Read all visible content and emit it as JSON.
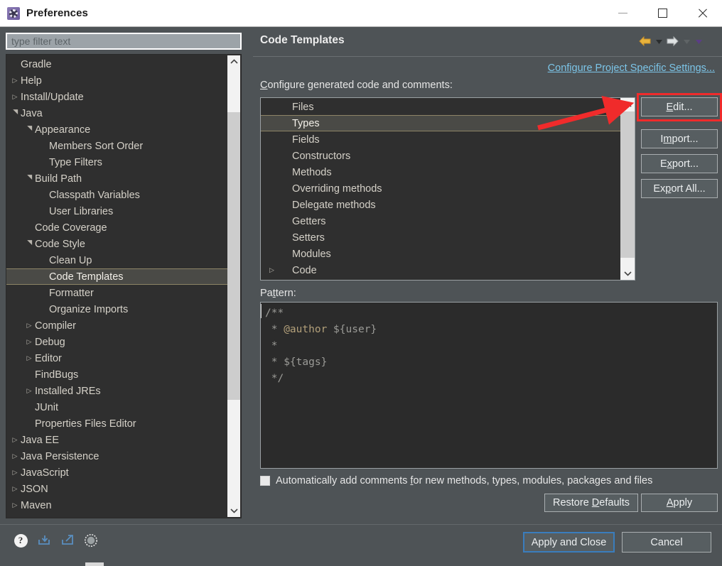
{
  "window": {
    "title": "Preferences",
    "app_icon": "gear-icon",
    "minimize": "—",
    "maximize": "□",
    "close": "✕"
  },
  "filter": {
    "placeholder": "type filter text",
    "value": ""
  },
  "sidebar": {
    "items": [
      {
        "label": "Gradle",
        "indent": 0,
        "twisty": "none",
        "selected": false
      },
      {
        "label": "Help",
        "indent": 0,
        "twisty": "collapsed",
        "selected": false
      },
      {
        "label": "Install/Update",
        "indent": 0,
        "twisty": "collapsed",
        "selected": false
      },
      {
        "label": "Java",
        "indent": 0,
        "twisty": "expanded",
        "selected": false
      },
      {
        "label": "Appearance",
        "indent": 1,
        "twisty": "expanded",
        "selected": false
      },
      {
        "label": "Members Sort Order",
        "indent": 2,
        "twisty": "none",
        "selected": false
      },
      {
        "label": "Type Filters",
        "indent": 2,
        "twisty": "none",
        "selected": false
      },
      {
        "label": "Build Path",
        "indent": 1,
        "twisty": "expanded",
        "selected": false
      },
      {
        "label": "Classpath Variables",
        "indent": 2,
        "twisty": "none",
        "selected": false
      },
      {
        "label": "User Libraries",
        "indent": 2,
        "twisty": "none",
        "selected": false
      },
      {
        "label": "Code Coverage",
        "indent": 1,
        "twisty": "none",
        "selected": false
      },
      {
        "label": "Code Style",
        "indent": 1,
        "twisty": "expanded",
        "selected": false
      },
      {
        "label": "Clean Up",
        "indent": 2,
        "twisty": "none",
        "selected": false
      },
      {
        "label": "Code Templates",
        "indent": 2,
        "twisty": "none",
        "selected": true
      },
      {
        "label": "Formatter",
        "indent": 2,
        "twisty": "none",
        "selected": false
      },
      {
        "label": "Organize Imports",
        "indent": 2,
        "twisty": "none",
        "selected": false
      },
      {
        "label": "Compiler",
        "indent": 1,
        "twisty": "collapsed",
        "selected": false
      },
      {
        "label": "Debug",
        "indent": 1,
        "twisty": "collapsed",
        "selected": false
      },
      {
        "label": "Editor",
        "indent": 1,
        "twisty": "collapsed",
        "selected": false
      },
      {
        "label": "FindBugs",
        "indent": 1,
        "twisty": "none",
        "selected": false
      },
      {
        "label": "Installed JREs",
        "indent": 1,
        "twisty": "collapsed",
        "selected": false
      },
      {
        "label": "JUnit",
        "indent": 1,
        "twisty": "none",
        "selected": false
      },
      {
        "label": "Properties Files Editor",
        "indent": 1,
        "twisty": "none",
        "selected": false
      },
      {
        "label": "Java EE",
        "indent": 0,
        "twisty": "collapsed",
        "selected": false
      },
      {
        "label": "Java Persistence",
        "indent": 0,
        "twisty": "collapsed",
        "selected": false
      },
      {
        "label": "JavaScript",
        "indent": 0,
        "twisty": "collapsed",
        "selected": false
      },
      {
        "label": "JSON",
        "indent": 0,
        "twisty": "collapsed",
        "selected": false
      },
      {
        "label": "Maven",
        "indent": 0,
        "twisty": "collapsed",
        "selected": false
      }
    ]
  },
  "page": {
    "title": "Code Templates",
    "project_specific_link": "Configure Project Specific Settings...",
    "list_label": "Configure generated code and comments:",
    "pattern_label": "Pattern:"
  },
  "nav": {
    "back_icon": "back-arrow-icon",
    "back_menu_icon": "chevron-down-icon",
    "forward_icon": "forward-arrow-icon",
    "forward_menu_icon": "chevron-down-icon",
    "view_menu_icon": "chevron-down-icon"
  },
  "templates_list": {
    "items": [
      {
        "label": "Files",
        "twisty": "none",
        "selected": false
      },
      {
        "label": "Types",
        "twisty": "none",
        "selected": true
      },
      {
        "label": "Fields",
        "twisty": "none",
        "selected": false
      },
      {
        "label": "Constructors",
        "twisty": "none",
        "selected": false
      },
      {
        "label": "Methods",
        "twisty": "none",
        "selected": false
      },
      {
        "label": "Overriding methods",
        "twisty": "none",
        "selected": false
      },
      {
        "label": "Delegate methods",
        "twisty": "none",
        "selected": false
      },
      {
        "label": "Getters",
        "twisty": "none",
        "selected": false
      },
      {
        "label": "Setters",
        "twisty": "none",
        "selected": false
      },
      {
        "label": "Modules",
        "twisty": "none",
        "selected": false
      },
      {
        "label": "Code",
        "twisty": "collapsed",
        "selected": false
      }
    ]
  },
  "side_buttons": {
    "edit": "Edit...",
    "edit_mnemonic": "E",
    "import": "Import...",
    "import_mnemonic": "m",
    "export": "Export...",
    "export_mnemonic": "x",
    "export_all": "Export All...",
    "export_all_mnemonic": "p"
  },
  "pattern": {
    "lines": [
      {
        "text": "/**"
      },
      {
        "text": " * ",
        "tag": "@author",
        "after": " ${user}"
      },
      {
        "text": " *"
      },
      {
        "text": " * ${tags}"
      },
      {
        "text": " */"
      }
    ],
    "raw": "/**\n * @author ${user}\n *\n * ${tags}\n */",
    "tag_color": "#b3a07a"
  },
  "checkbox": {
    "label": "Automatically add comments for new methods, types, modules, packages and files",
    "checked": false
  },
  "bottom_buttons": {
    "restore_defaults": "Restore Defaults",
    "apply": "Apply"
  },
  "footer": {
    "help_icon": "help-icon",
    "import_icon": "import-arrow-icon",
    "export_icon": "export-arrow-icon",
    "oomph_icon": "oomph-circle-icon",
    "apply_and_close": "Apply and Close",
    "cancel": "Cancel"
  },
  "annotation": {
    "arrow_color": "#f02b2b",
    "highlight_color": "#f02b2b",
    "target": "edit-button"
  },
  "colors": {
    "window_bg": "#4e5356",
    "list_bg": "#2f2f2f",
    "text": "#d5d1c8",
    "link": "#7cc5e8",
    "selection_border": "#8d8466",
    "focus_blue": "#3a7dbd"
  }
}
